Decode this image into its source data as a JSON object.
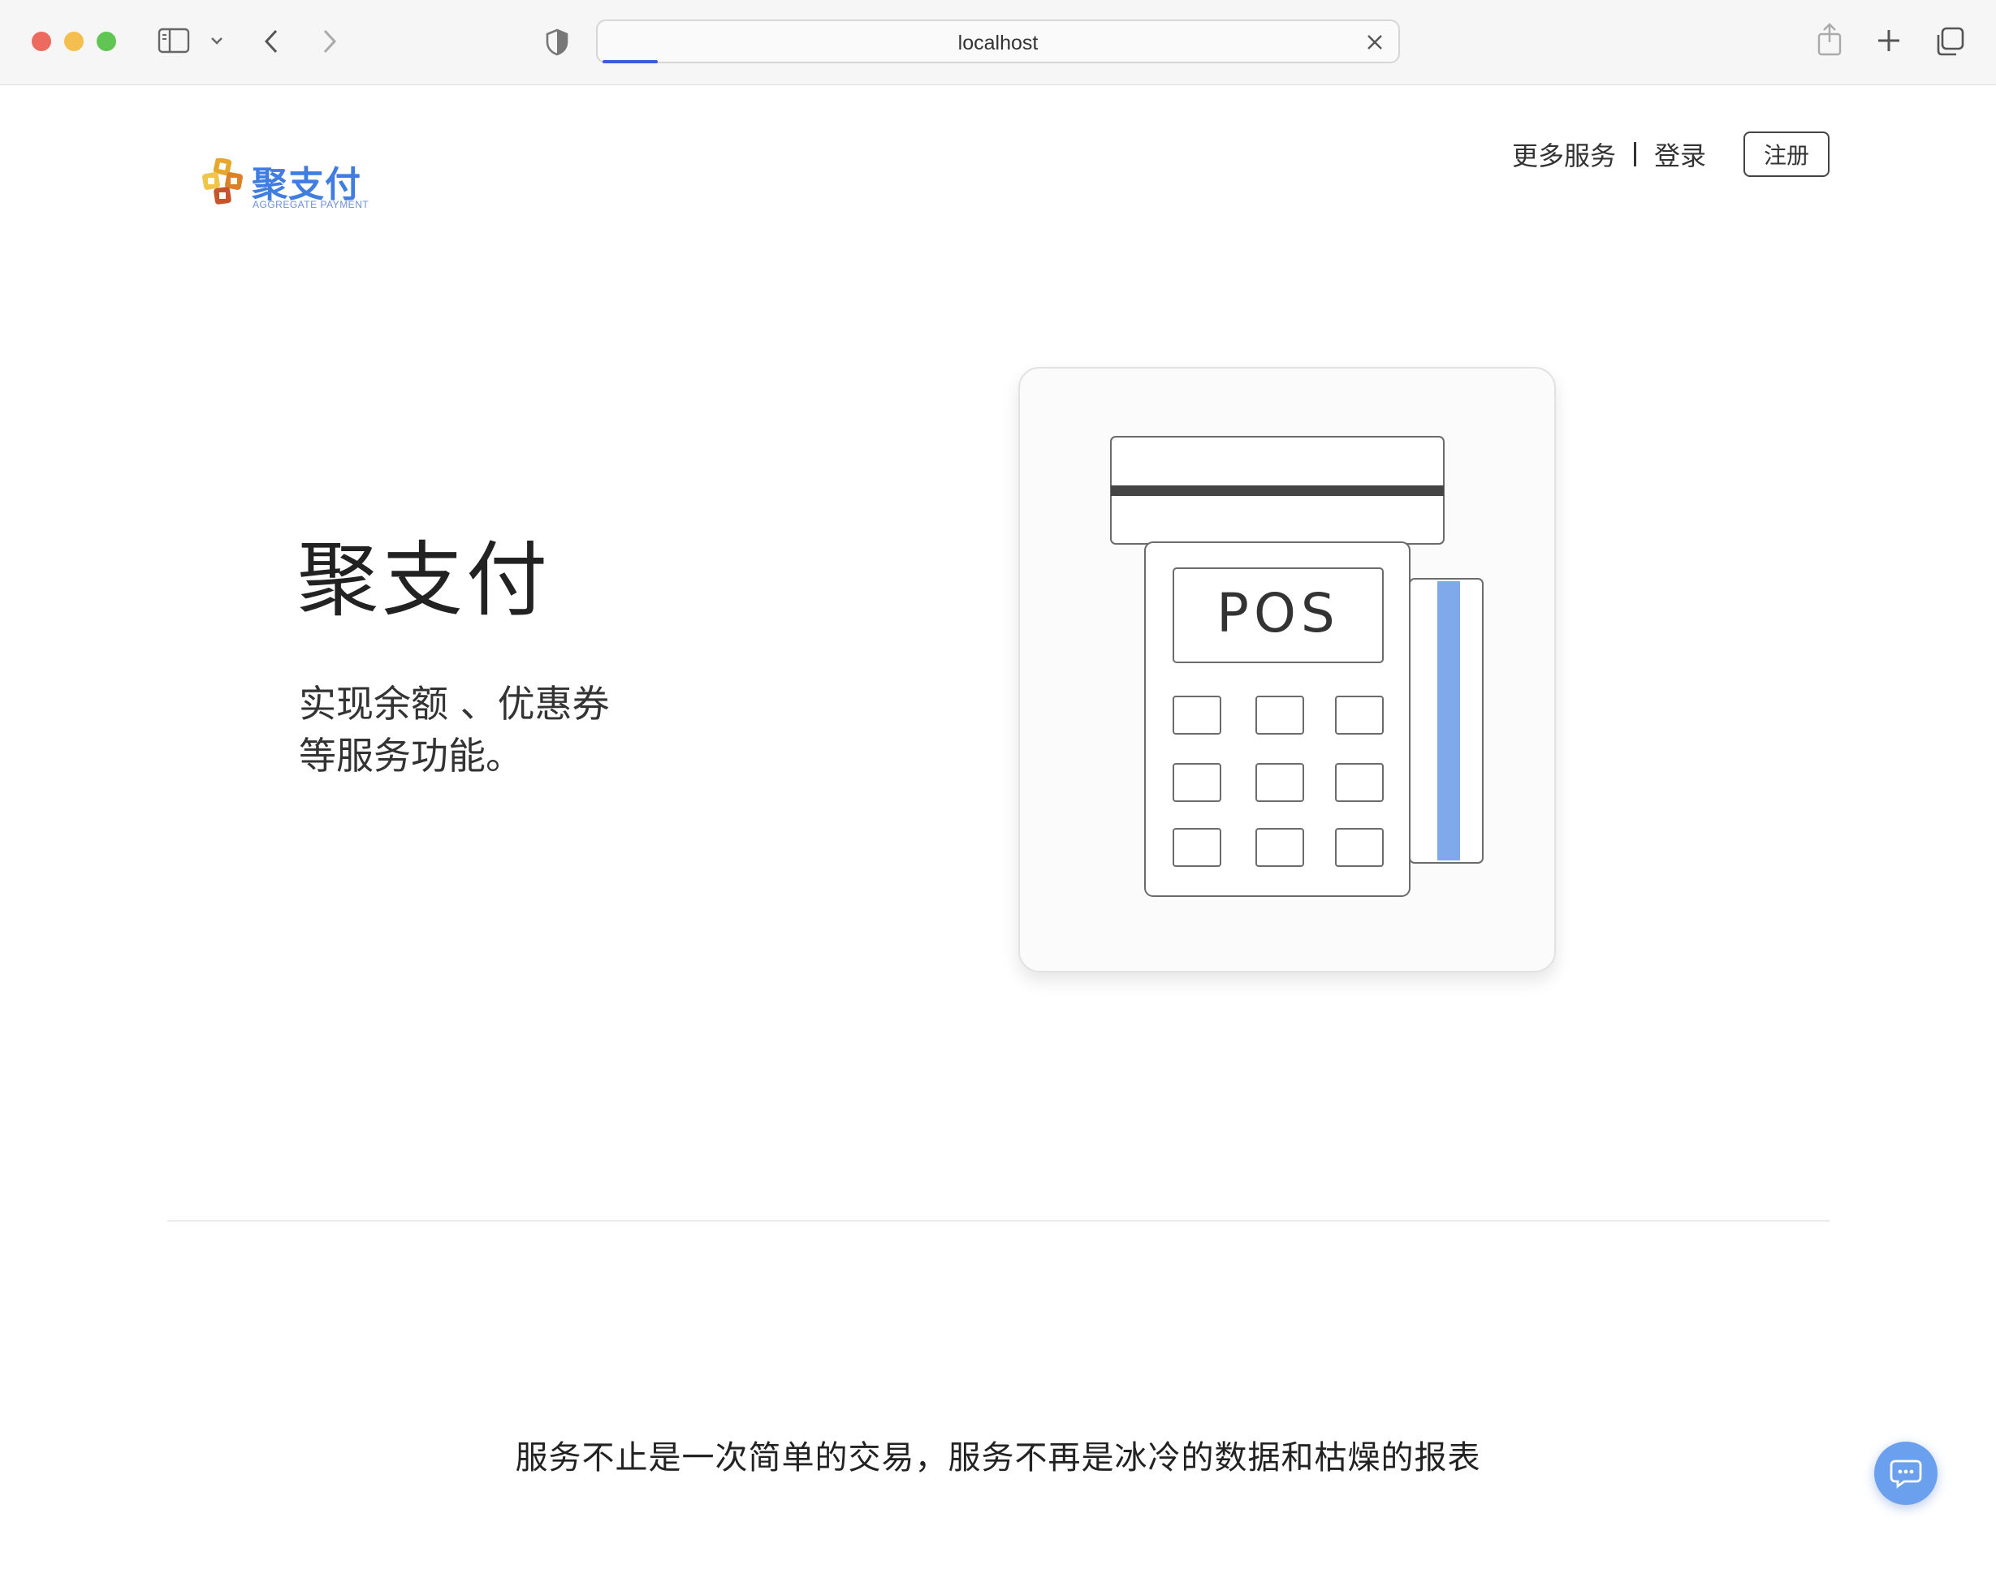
{
  "browser": {
    "url": "localhost",
    "page_load_progress": 0.07
  },
  "header": {
    "logo_cn": "聚支付",
    "logo_en": "AGGREGATE PAYMENT",
    "nav_more_services": "更多服务",
    "nav_login": "登录",
    "nav_register": "注册"
  },
  "hero": {
    "title": "聚支付",
    "subtitle_line1": "实现余额 、优惠券",
    "subtitle_line2": "等服务功能。",
    "illustration": {
      "screen_text": "POS",
      "card_stripe_color": "#7fa9ea"
    }
  },
  "slogan": "服务不止是一次简单的交易，服务不再是冰冷的数据和枯燥的报表",
  "colors": {
    "brand_blue": "#3f7de0",
    "logo_orange": "#e08a2c",
    "chat_button": "#6aa0ee"
  },
  "icons": [
    "sidebar-icon",
    "chevron-down-icon",
    "back-icon",
    "forward-icon",
    "shield-icon",
    "close-icon",
    "share-icon",
    "plus-icon",
    "tabs-icon",
    "chat-icon"
  ]
}
